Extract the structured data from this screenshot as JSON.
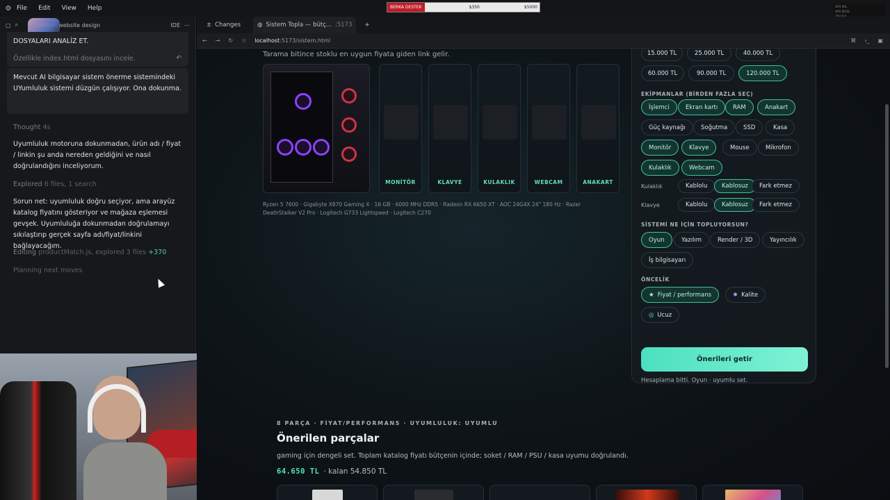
{
  "menubar": {
    "items": [
      "File",
      "Edit",
      "View",
      "Help"
    ]
  },
  "donation": {
    "label": "BERKA DESTEK",
    "current": "$350",
    "goal": "$5000"
  },
  "sysmon": {
    "lines": [
      "GPU KUL",
      "GPU SICKL",
      "CPU KUL",
      "CPU TEMP"
    ]
  },
  "leftpane": {
    "title": "ulation website design",
    "ide_label": "IDE",
    "msg1_line1": "DOSYALARI ANALİZ ET.",
    "msg1_line2": "Özellikle index.html dosyasını incele.",
    "msg2": "Mevcut AI bilgisayar sistem önerme sistemindeki UYumluluk sistemi düzgün çalışıyor. Ona dokunma.",
    "thought": "Thought",
    "thought_time": "4s",
    "para1": "Uyumluluk motoruna dokunmadan, ürün adı / fiyat / linkin şu anda nereden geldiğini ve nasıl doğrulandığını inceliyorum.",
    "explored": "Explored",
    "explored_detail": "6 files, 1 search",
    "para2": "Sorun net: uyumluluk doğru seçiyor, ama arayüz katalog fiyatını gösteriyor ve mağaza eşlemesi gevşek. Uyumluluğa dokunmadan doğrulamayı sıkılaştırıp gerçek sayfa adı/fiyat/linkini bağlayacağım.",
    "editing": "Editing",
    "editing_detail": "productMatch.js, explored 3 files",
    "editing_delta": "+370",
    "planning": "Planning next moves"
  },
  "browser": {
    "tab_changes": "Changes",
    "tab_active": "Sistem Topla — bütç...",
    "tab_port": ":5173",
    "url_host": "localhost",
    "url_path": ":5173/sistem.html"
  },
  "page": {
    "subtitle": "Tarama bitince stoklu en uygun fiyata giden link gelir.",
    "slots": [
      "MONİTÖR",
      "KLAVYE",
      "KULAKLIK",
      "WEBCAM",
      "ANAKART"
    ],
    "parts_line": "Ryzen 5 7600 · Gigabyte X870 Gaming X · 16 GB · 6000 MHz DDR5 · Radeon RX 6650 XT · AOC 24G4X 24\" 180 Hz · Razer DeathStalker V2 Pro · Logitech G733 Lightspeed · Logitech C270",
    "budget": {
      "row1": [
        "15.000 TL",
        "25.000 TL",
        "40.000 TL"
      ],
      "row2": [
        "60.000 TL",
        "90.000 TL",
        "120.000 TL"
      ],
      "selected": "120.000 TL"
    },
    "equip_title": "EKİPMANLAR (BİRDEN FAZLA SEÇ)",
    "equip": [
      "İşlemci",
      "Ekran kartı",
      "RAM",
      "Anakart",
      "Güç kaynağı",
      "Soğutma",
      "SSD",
      "Kasa",
      "Monitör",
      "Klavye",
      "Mouse",
      "Mikrofon",
      "Kulaklık",
      "Webcam"
    ],
    "headset_label": "Kulaklık",
    "keyboard_label": "Klavye",
    "conn": [
      "Kablolu",
      "Kablosuz",
      "Fark etmez"
    ],
    "purpose_title": "SİSTEMİ NE İÇİN TOPLUYORSUN?",
    "purpose": [
      "Oyun",
      "Yazılım",
      "Render / 3D",
      "Yayıncılık",
      "İş bilgisayarı"
    ],
    "priority_title": "ÖNCELİK",
    "priority": [
      "Fiyat / performans",
      "Kalite",
      "Ucuz"
    ],
    "cta": "Önerileri getir",
    "calc_note": "Hesaplama bitti. Oyun · uyumlu set.",
    "kicker": "8 PARÇA · FİYAT/PERFORMANS · UYUMLULUK: UYUMLU",
    "heading": "Önerilen parçalar",
    "description": "gaming için dengeli set. Toplam katalog fiyatı bütçenin içinde; soket / RAM / PSU / kasa uyumu doğrulandı.",
    "total": "64.650 TL",
    "remaining": "· kalan 54.850 TL"
  },
  "colors": {
    "accent": "#4fe3c1",
    "selected_chip": "#14352f"
  }
}
